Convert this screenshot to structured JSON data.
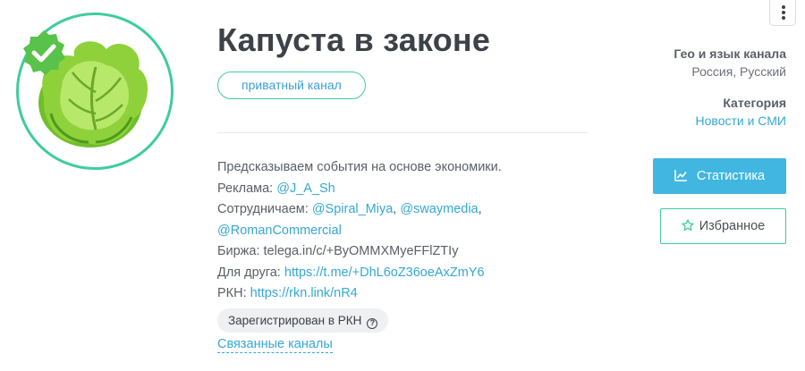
{
  "channel": {
    "title": "Капуста в законе",
    "type_badge": "приватный канал",
    "avatar_icon": "cabbage-icon",
    "verified_icon": "verified-check-icon"
  },
  "description": {
    "line1": "Предсказываем события на основе экономики.",
    "ads_label": "Реклама: ",
    "ads_link": "@J_A_Sh",
    "collab_label": "Сотрудничаем: ",
    "collab_link1": "@Spiral_Miya",
    "sep1": ", ",
    "collab_link2": "@swaymedia",
    "sep2": ",",
    "collab_link3": "@RomanCommercial",
    "exchange": "Биржа: telega.in/c/+ByOMMXMyeFFlZTIy",
    "friend_label": "Для друга: ",
    "friend_link": "https://t.me/+DhL6oZ36oeAxZmY6",
    "rkn_label": "РКН: ",
    "rkn_link": "https://rkn.link/nR4"
  },
  "rkn_badge": "Зарегистрирован в РКН",
  "related_link": "Связанные каналы",
  "sidebar": {
    "geo_label": "Гео и язык канала",
    "geo_value": "Россия, Русский",
    "category_label": "Категория",
    "category_value": "Новости и СМИ"
  },
  "buttons": {
    "stats": "Статистика",
    "favorite": "Избранное"
  },
  "colors": {
    "accent_green": "#3fcc9b",
    "link_blue": "#35a7d6",
    "button_blue": "#41b6e0"
  }
}
